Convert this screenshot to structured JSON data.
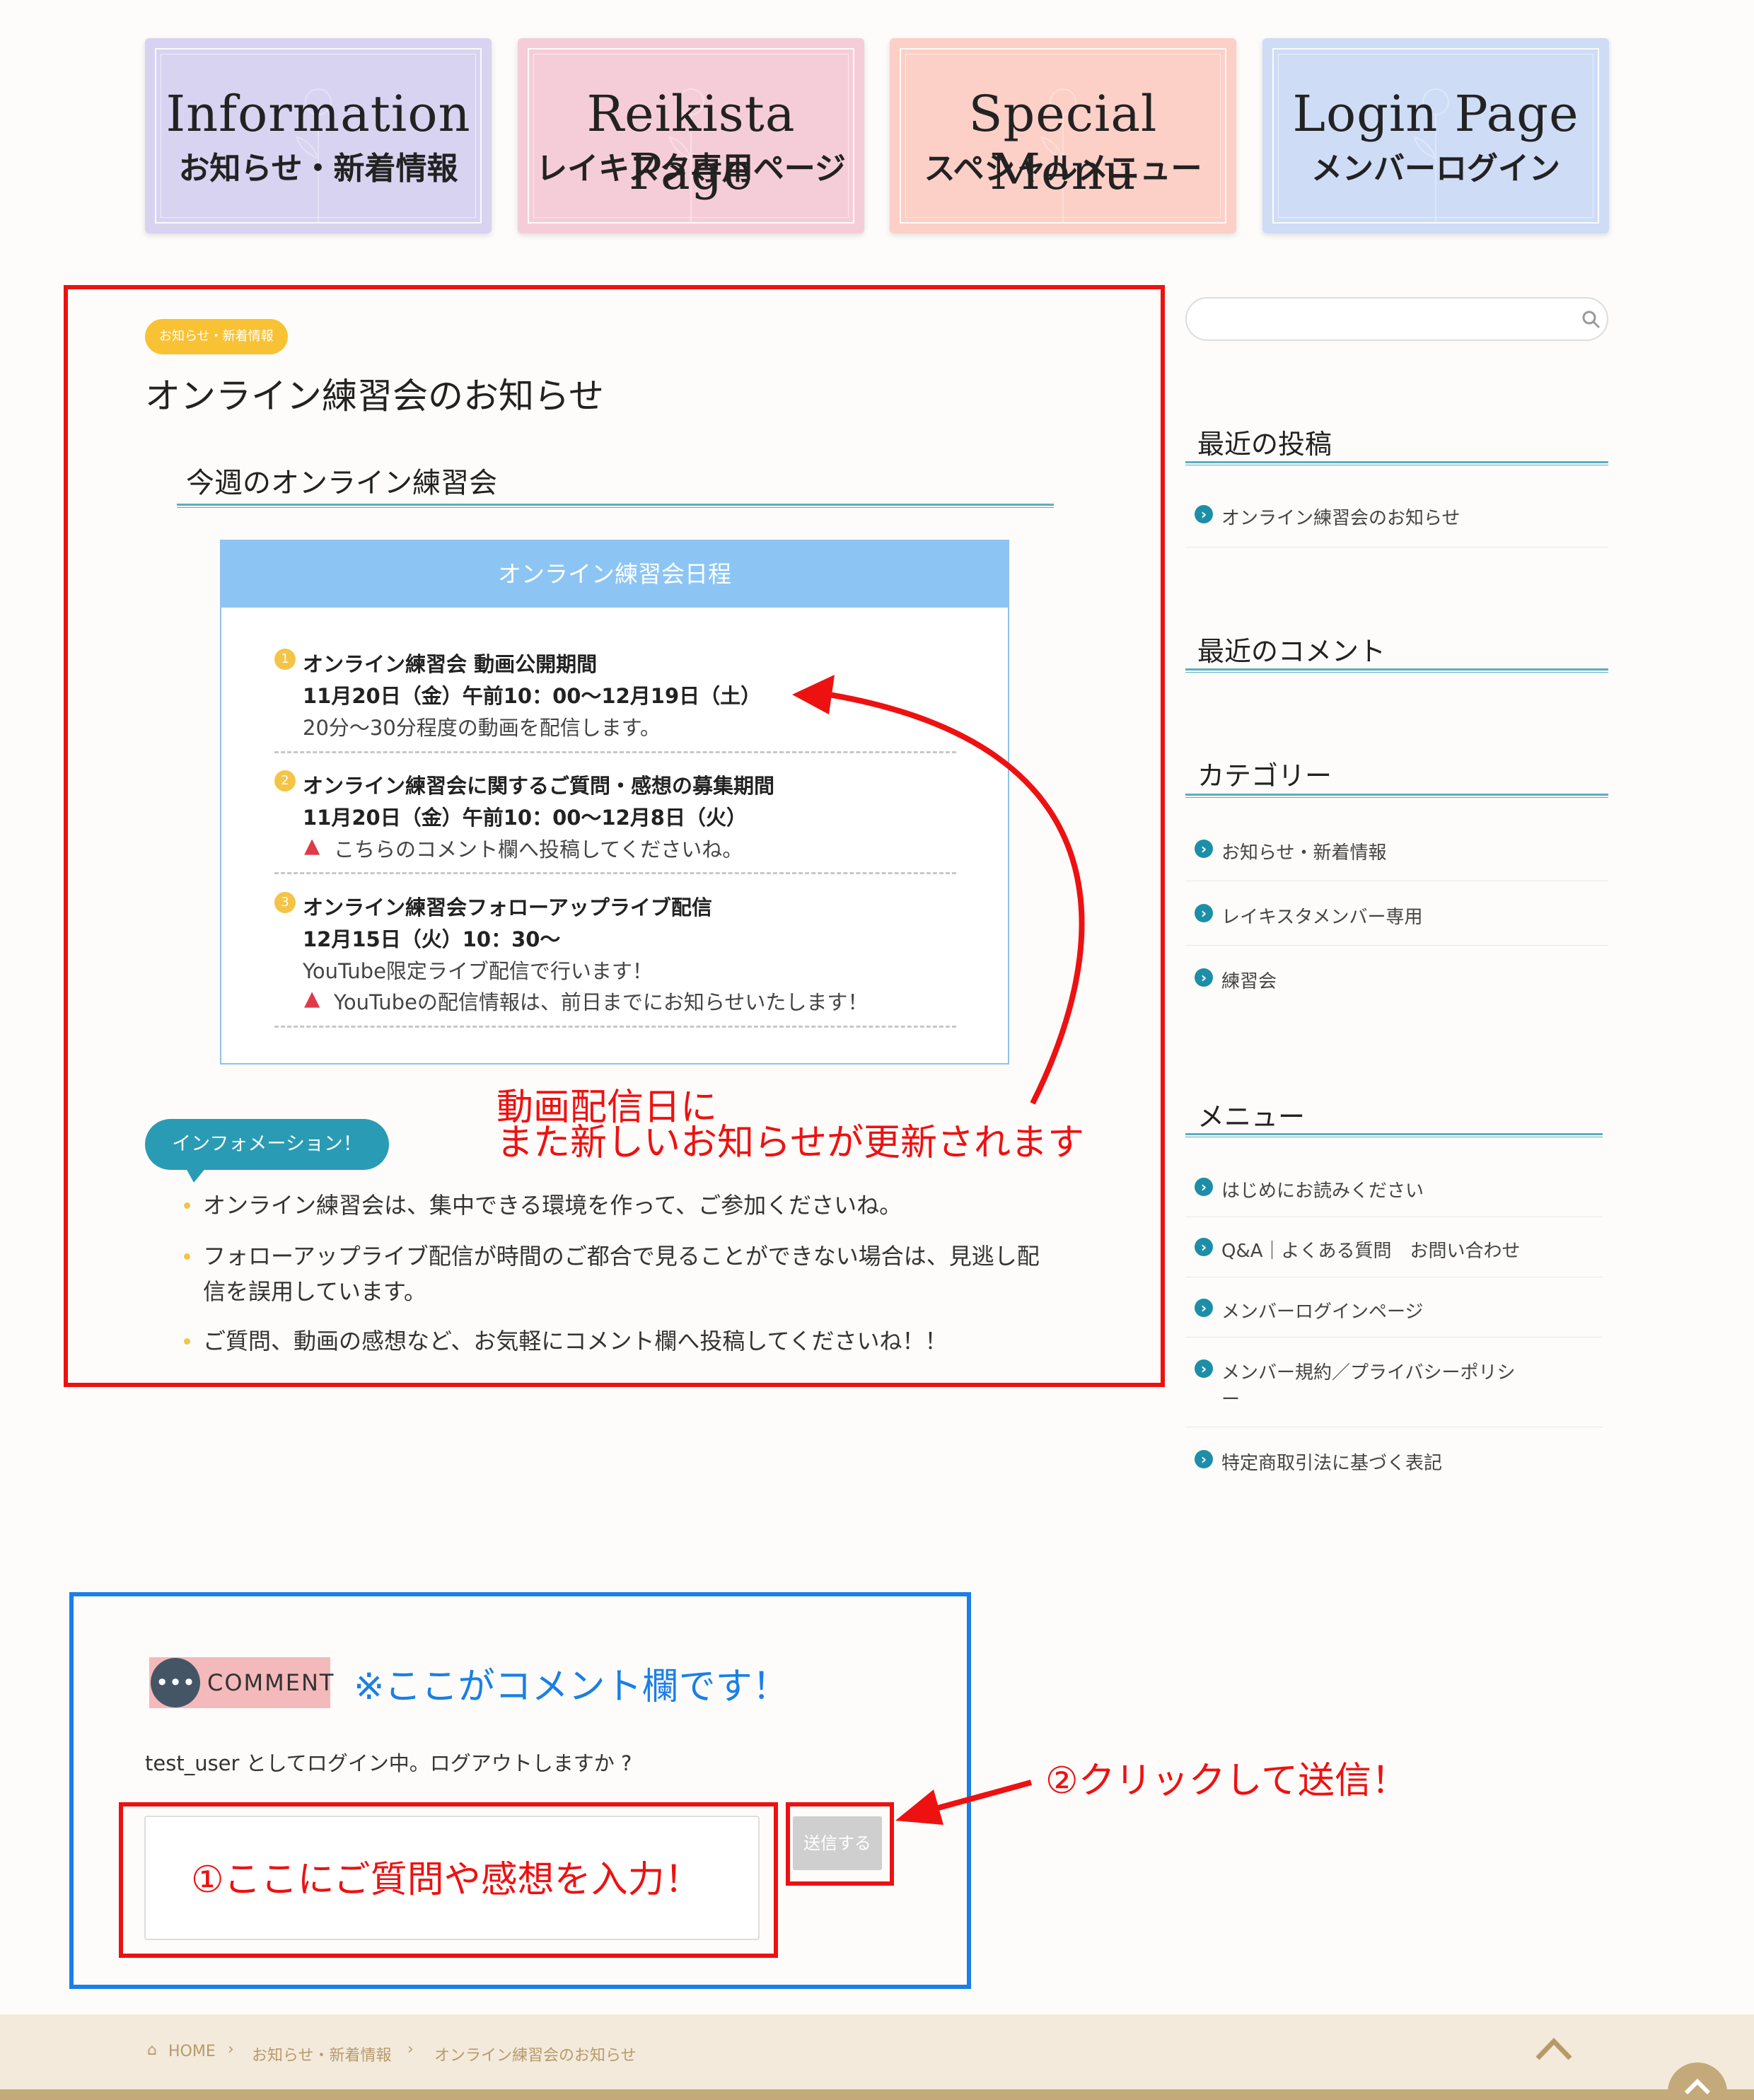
{
  "banners": [
    {
      "en": "Information",
      "ja": "お知らせ・新着情報",
      "color": "#d8d3f0"
    },
    {
      "en": "Reikista Page",
      "ja": "レイキスタ専用ページ",
      "color": "#f5cdd8"
    },
    {
      "en": "Special Menu",
      "ja": "スペシャルメニュー",
      "color": "#fccfc7"
    },
    {
      "en": "Login Page",
      "ja": "メンバーログイン",
      "color": "#cfdcf6"
    }
  ],
  "article": {
    "category_tag": "お知らせ・新着情報",
    "title": "オンライン練習会のお知らせ",
    "heading": "今週のオンライン練習会",
    "schedule_title": "オンライン練習会日程",
    "items": [
      {
        "num": "1",
        "title": "オンライン練習会 動画公開期間",
        "date": "11月20日（金）午前10：00〜12月19日（土）",
        "note": "20分〜30分程度の動画を配信します。"
      },
      {
        "num": "2",
        "title": "オンライン練習会に関するご質問・感想の募集期間",
        "date": "11月20日（金）午前10：00〜12月8日（火）",
        "warn": "こちらのコメント欄へ投稿してくださいね。"
      },
      {
        "num": "3",
        "title": "オンライン練習会フォローアップライブ配信",
        "date": "12月15日（火）10：30〜",
        "note": "YouTube限定ライブ配信で行います！",
        "warn": "YouTubeの配信情報は、前日までにお知らせいたします！"
      }
    ],
    "annotation_line1": "動画配信日に",
    "annotation_line2": "また新しいお知らせが更新されます",
    "info_label": "インフォメーション！",
    "bullets": [
      "オンライン練習会は、集中できる環境を作って、ご参加くださいね。",
      "フォローアップライブ配信が時間のご都合で見ることができない場合は、見逃し配",
      "信を誤用しています。",
      "ご質問、動画の感想など、お気軽にコメント欄へ投稿してくださいね！！"
    ]
  },
  "sidebar": {
    "recent_posts_heading": "最近の投稿",
    "recent_posts": [
      "オンライン練習会のお知らせ"
    ],
    "recent_comments_heading": "最近のコメント",
    "categories_heading": "カテゴリー",
    "categories": [
      "お知らせ・新着情報",
      "レイキスタメンバー専用",
      "練習会"
    ],
    "menu_heading": "メニュー",
    "menu": [
      "はじめにお読みください",
      "Q&A｜よくある質問　お問い合わせ",
      "メンバーログインページ",
      "メンバー規約／プライバシーポリシ",
      "ー",
      "特定商取引法に基づく表記"
    ]
  },
  "comment": {
    "label": "COMMENT",
    "note": "※ここがコメント欄です！",
    "login_text": "test_user としてログイン中。ログアウトしますか ?",
    "textarea_annotation": "①ここにご質問や感想を入力！",
    "send_label": "送信する",
    "send_annotation": "②クリックして送信！"
  },
  "breadcrumb": {
    "home": "HOME",
    "category": "お知らせ・新着情報",
    "current": "オンライン練習会のお知らせ"
  },
  "colors": {
    "accent": "#1d8ea8",
    "annotation_red": "#ee1111",
    "annotation_blue": "#1a7fe6",
    "tag_yellow": "#f9c234"
  }
}
